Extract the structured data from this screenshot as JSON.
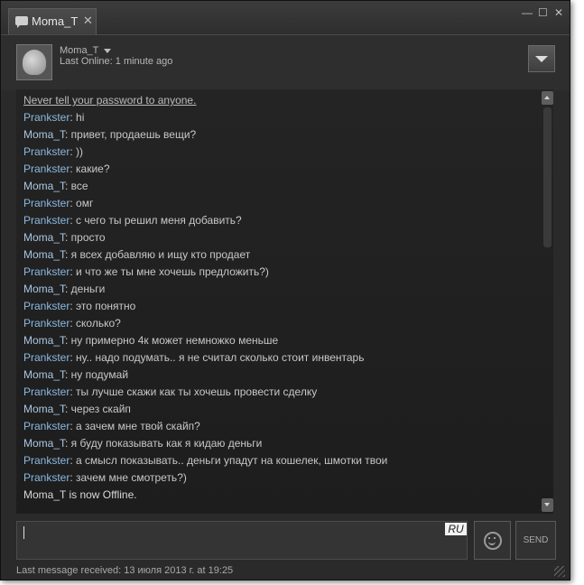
{
  "tab": {
    "label": "Moma_T",
    "close": "✕",
    "icon": "chat-bubble-icon"
  },
  "window_controls": {
    "minimize": "—",
    "maximize": "☐",
    "close": "✕"
  },
  "header": {
    "friend_name": "Moma_T",
    "status_label": "Last Online:",
    "status_value": "1 minute ago"
  },
  "log": {
    "warning": "Never tell your password to anyone.",
    "messages": [
      {
        "sender": "Prankster",
        "text": ": hi"
      },
      {
        "sender": "Moma_T",
        "text": ": привет, продаешь вещи?"
      },
      {
        "sender": "Prankster",
        "text": ": ))"
      },
      {
        "sender": "Prankster",
        "text": ": какие?"
      },
      {
        "sender": "Moma_T",
        "text": ": все"
      },
      {
        "sender": "Prankster",
        "text": ": омг"
      },
      {
        "sender": "Prankster",
        "text": ": с чего ты решил меня добавить?"
      },
      {
        "sender": "Moma_T",
        "text": ": просто"
      },
      {
        "sender": "Moma_T",
        "text": ": я всех добавляю и ищу кто продает"
      },
      {
        "sender": "Prankster",
        "text": ": и что же ты мне хочешь предложить?)"
      },
      {
        "sender": "Moma_T",
        "text": ": деньги"
      },
      {
        "sender": "Prankster",
        "text": ": это понятно"
      },
      {
        "sender": "Prankster",
        "text": ": сколько?"
      },
      {
        "sender": "Moma_T",
        "text": ": ну примерно 4к может немножко меньше"
      },
      {
        "sender": "Prankster",
        "text": ": ну.. надо подумать.. я не считал сколько стоит инвентарь"
      },
      {
        "sender": "Moma_T",
        "text": ": ну подумай"
      },
      {
        "sender": "Prankster",
        "text": ": ты лучше скажи как ты хочешь провести сделку"
      },
      {
        "sender": "Moma_T",
        "text": ": через скайп"
      },
      {
        "sender": "Prankster",
        "text": ": а зачем мне твой скайп?"
      },
      {
        "sender": "Moma_T",
        "text": ": я буду показывать как я кидаю деньги"
      },
      {
        "sender": "Prankster",
        "text": ": а смысл показывать.. деньги упадут на кошелек, шмотки твои"
      },
      {
        "sender": "Prankster",
        "text": ": зачем мне смотреть?)"
      }
    ],
    "system": "Moma_T is now Offline."
  },
  "input": {
    "value": "",
    "lang_badge": "RU"
  },
  "buttons": {
    "send": "SEND",
    "emoji_icon": "smiley-icon"
  },
  "footer": {
    "label": "Last message received:",
    "value": "13 июля 2013 г. at 19:25"
  },
  "colors": {
    "background": "#2a2a2a",
    "my_name": "#8bb8e0",
    "friend_name": "#a9c7e3",
    "text": "#c8c8c8"
  }
}
